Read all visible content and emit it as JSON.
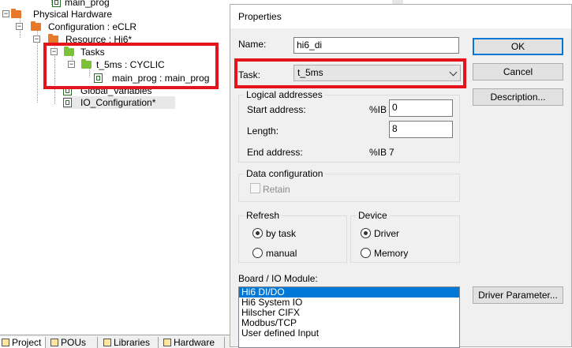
{
  "tree": {
    "nodes": [
      {
        "label": "main_prog"
      },
      {
        "label": "Physical Hardware"
      },
      {
        "label": "Configuration : eCLR"
      },
      {
        "label": "Resource : Hi6*"
      },
      {
        "label": "Tasks"
      },
      {
        "label": "t_5ms : CYCLIC"
      },
      {
        "label": "main_prog : main_prog"
      },
      {
        "label": "Global_Variables"
      },
      {
        "label": "IO_Configuration*"
      }
    ]
  },
  "bottom_tabs": [
    "Project",
    "POUs",
    "Libraries",
    "Hardware"
  ],
  "dialog": {
    "title": "Properties",
    "name_label": "Name:",
    "name_value": "hi6_di",
    "task_label": "Task:",
    "task_value": "t_5ms",
    "buttons": {
      "ok": "OK",
      "cancel": "Cancel",
      "description": "Description...",
      "driver_param": "Driver Parameter..."
    },
    "logical": {
      "title": "Logical addresses",
      "start_label": "Start address:",
      "start_prefix": "%IB",
      "start_value": "0",
      "length_label": "Length:",
      "length_value": "8",
      "end_label": "End address:",
      "end_prefix": "%IB",
      "end_value": "7"
    },
    "data_config": {
      "title": "Data configuration",
      "retain_label": "Retain",
      "retain_checked": false
    },
    "refresh": {
      "title": "Refresh",
      "options": [
        "by task",
        "manual"
      ],
      "selected": "by task"
    },
    "device": {
      "title": "Device",
      "options": [
        "Driver",
        "Memory"
      ],
      "selected": "Driver"
    },
    "board": {
      "label": "Board / IO Module:",
      "items": [
        "Hi6 DI/DO",
        "Hi6 System IO",
        "Hilscher CIFX",
        "Modbus/TCP",
        "User defined Input"
      ],
      "selected": "Hi6 DI/DO"
    }
  },
  "colors": {
    "highlight": "#e3141b",
    "selection": "#0078d7",
    "folder_orange": "#e8792a",
    "folder_green": "#7cc13a"
  }
}
